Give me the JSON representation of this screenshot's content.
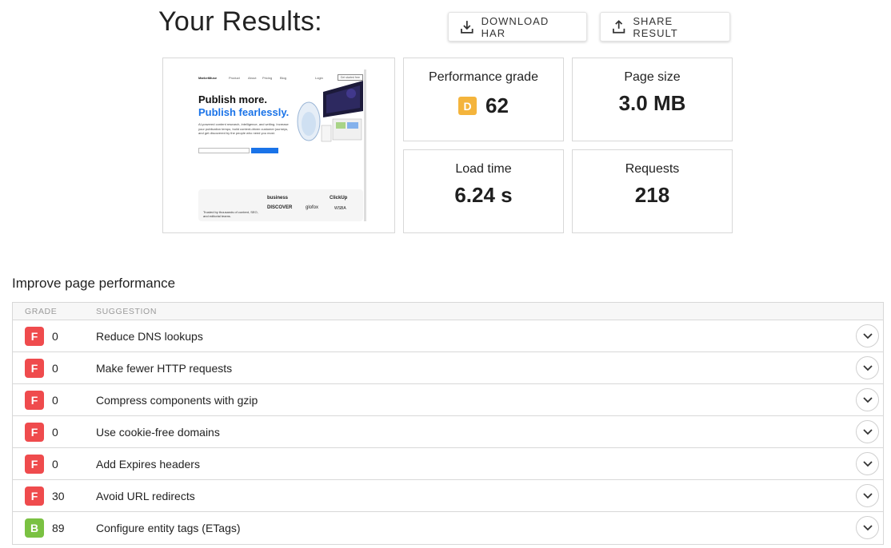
{
  "header": {
    "title": "Your Results:",
    "download_label": "DOWNLOAD HAR",
    "share_label": "SHARE RESULT"
  },
  "screenshot": {
    "nav_logo": "MarketMuse",
    "nav_items": [
      "Product",
      "About",
      "Pricing",
      "Blog"
    ],
    "nav_login": "Login",
    "nav_cta": "Get started free",
    "headline_1": "Publish more.",
    "headline_2": "Publish fearlessly.",
    "paragraph": "AI-powered content research, intelligence, and writing. Increase your publication tempo, build content-driven customer journeys, and get discovered by the people who need you most.",
    "trust_text": "Trusted by thousands of content, SEO, and editorial teams.",
    "logos": [
      "business",
      "ClickUp",
      "DISCOVER",
      "glofox",
      "WSBA"
    ]
  },
  "metrics": {
    "grade_label": "Performance grade",
    "grade_letter": "D",
    "grade_score": "62",
    "size_label": "Page size",
    "size_value": "3.0 MB",
    "load_label": "Load time",
    "load_value": "6.24 s",
    "requests_label": "Requests",
    "requests_value": "218"
  },
  "improve": {
    "title": "Improve page performance",
    "col_grade": "GRADE",
    "col_suggestion": "SUGGESTION",
    "rows": [
      {
        "grade": "F",
        "score": "0",
        "text": "Reduce DNS lookups"
      },
      {
        "grade": "F",
        "score": "0",
        "text": "Make fewer HTTP requests"
      },
      {
        "grade": "F",
        "score": "0",
        "text": "Compress components with gzip"
      },
      {
        "grade": "F",
        "score": "0",
        "text": "Use cookie-free domains"
      },
      {
        "grade": "F",
        "score": "0",
        "text": "Add Expires headers"
      },
      {
        "grade": "F",
        "score": "30",
        "text": "Avoid URL redirects"
      },
      {
        "grade": "B",
        "score": "89",
        "text": "Configure entity tags (ETags)"
      }
    ]
  },
  "colors": {
    "grade_f": "#ef4b4d",
    "grade_d": "#f4b43c",
    "grade_b": "#7ac142",
    "accent_blue": "#1a73e8"
  }
}
